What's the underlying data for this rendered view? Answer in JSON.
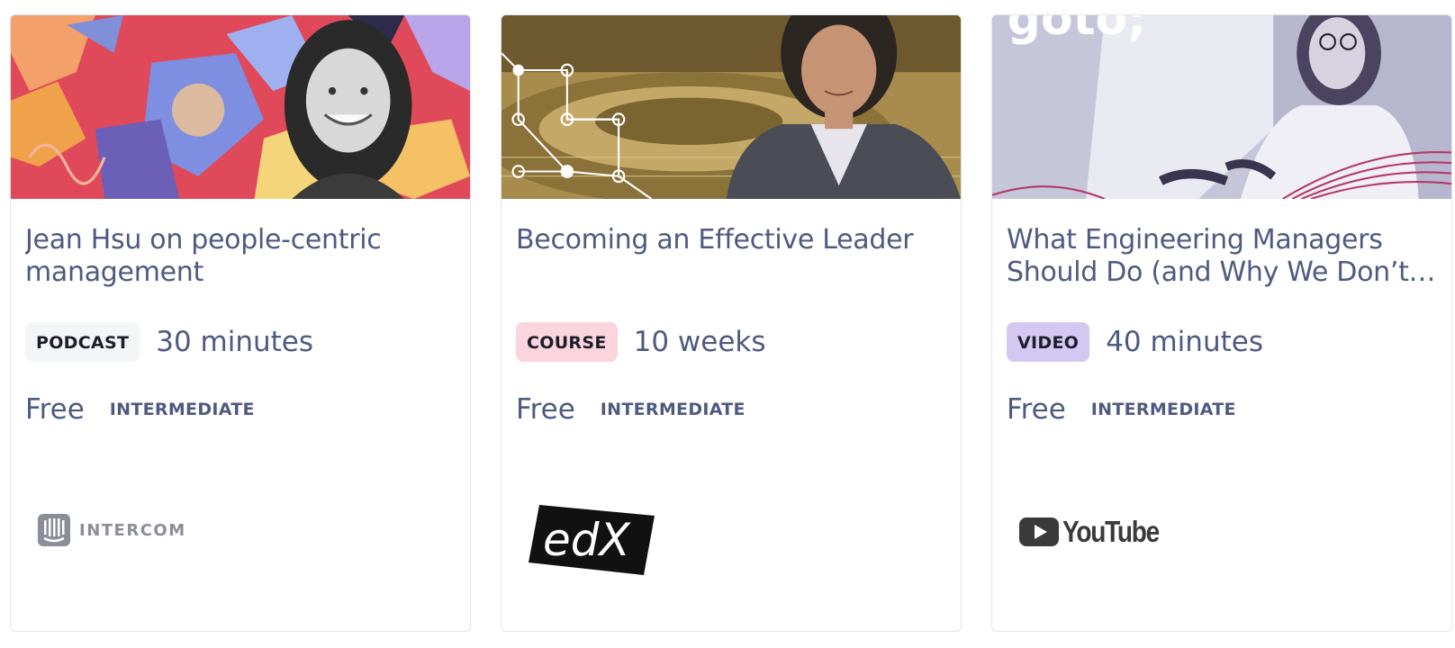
{
  "cards": [
    {
      "title": "Jean Hsu on people-centric management",
      "type": "PODCAST",
      "duration": "30 minutes",
      "price": "Free",
      "level": "INTERMEDIATE",
      "provider": "INTERCOM",
      "thumb_icon": "portrait-collage-image"
    },
    {
      "title": "Becoming an Effective Leader",
      "type": "COURSE",
      "duration": "10 weeks",
      "price": "Free",
      "level": "INTERMEDIATE",
      "provider": "edX",
      "thumb_icon": "speaker-portrait-image"
    },
    {
      "title": "What Engineering Managers Should Do (and Why We Don’t) -…",
      "type": "VIDEO",
      "duration": "40 minutes",
      "price": "Free",
      "level": "INTERMEDIATE",
      "provider": "YouTube",
      "thumb_icon": "conference-talk-image",
      "thumb_text": "goto;"
    }
  ],
  "colors": {
    "text": "#4f5a80",
    "podcast_badge": "#f4f5f7",
    "course_badge": "#fbd5dd",
    "video_badge": "#d4c7f2"
  }
}
